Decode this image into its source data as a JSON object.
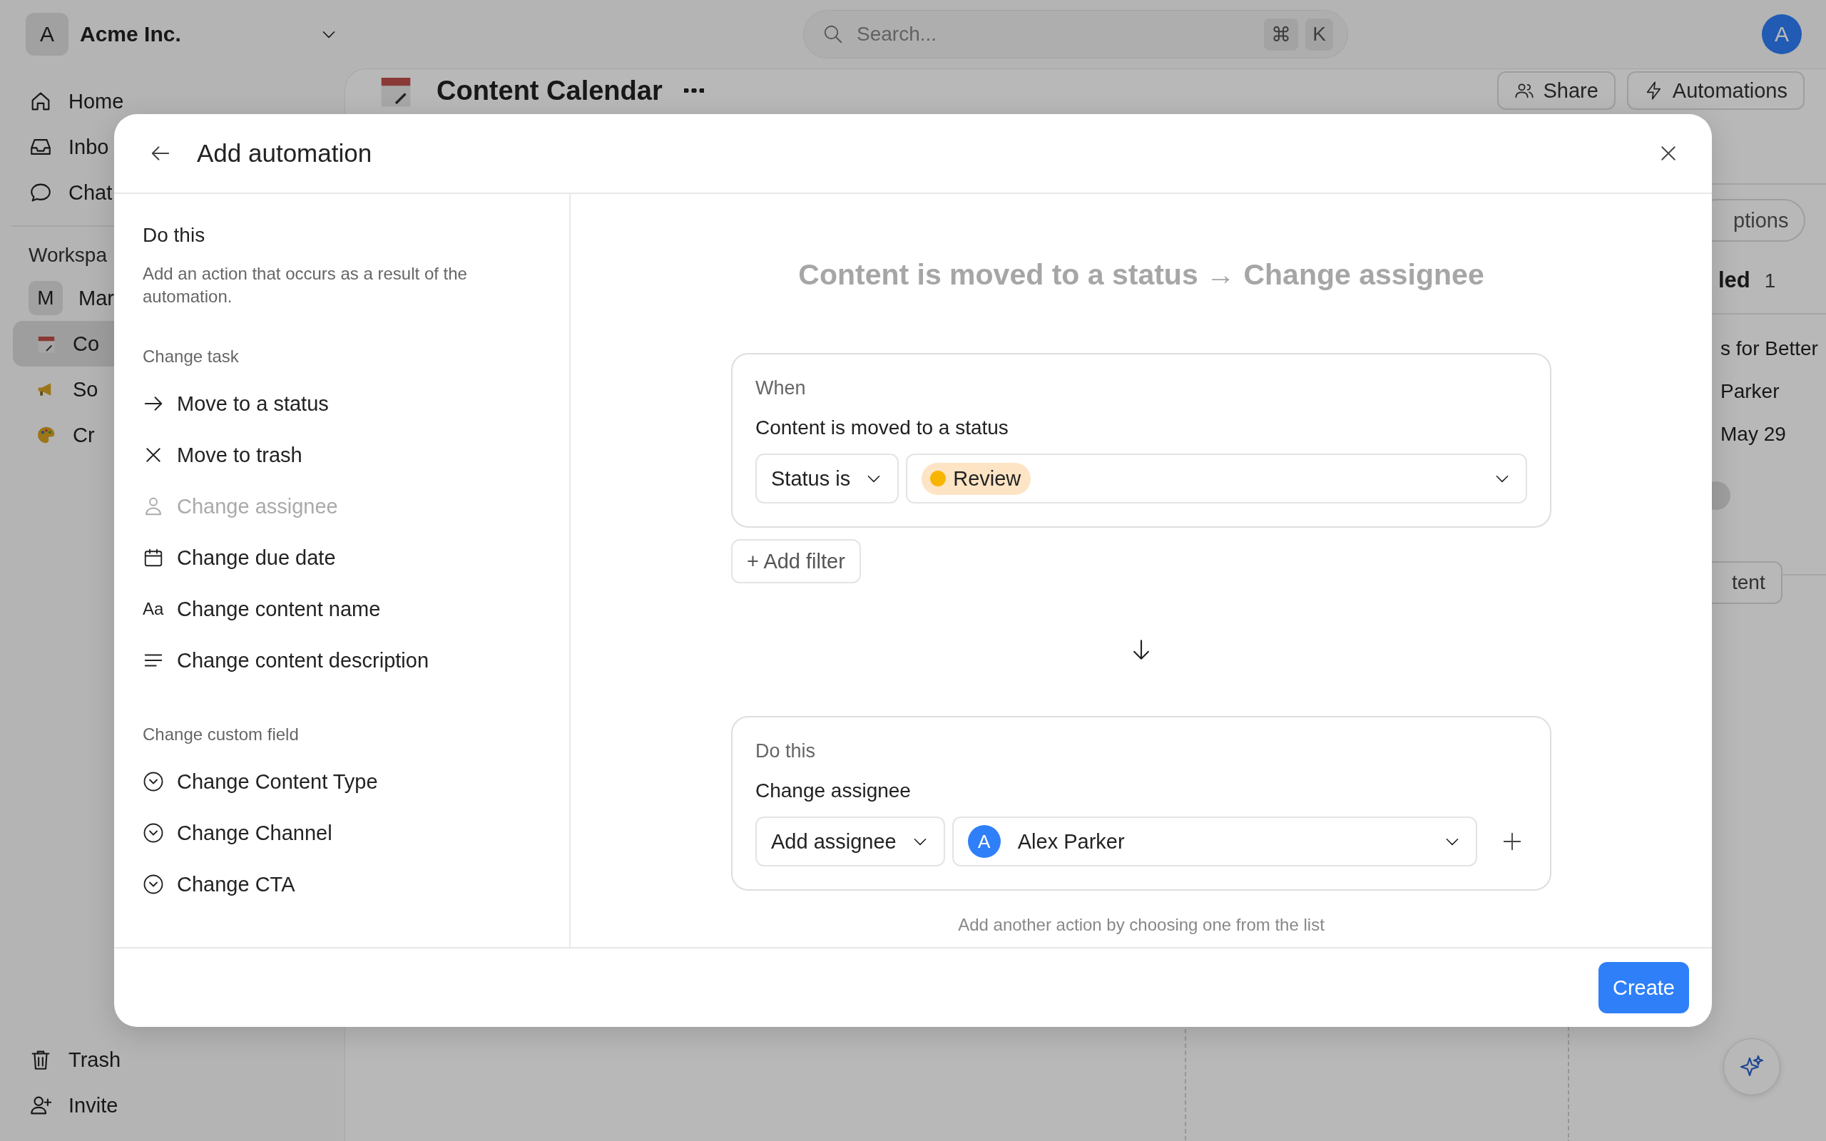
{
  "workspace": {
    "avatar": "A",
    "name": "Acme Inc."
  },
  "search": {
    "placeholder": "Search...",
    "keys": [
      "⌘",
      "K"
    ]
  },
  "user": {
    "avatar": "A"
  },
  "sidebar": {
    "nav": [
      {
        "kind": "home",
        "label": "Home"
      },
      {
        "kind": "inbox",
        "label": "Inbo"
      },
      {
        "kind": "chat",
        "label": "Chat"
      }
    ],
    "section": "Workspa",
    "workspace": {
      "avatar": "M",
      "name": "Mar"
    },
    "items": [
      {
        "kind": "calendar",
        "label": "Co",
        "selected": true
      },
      {
        "kind": "megaphone",
        "label": "So",
        "selected": false
      },
      {
        "kind": "palette",
        "label": "Cr",
        "selected": false
      }
    ],
    "footer": [
      {
        "kind": "trash",
        "label": "Trash"
      },
      {
        "kind": "invite",
        "label": "Invite"
      }
    ]
  },
  "page": {
    "title": "Content Calendar",
    "actions": [
      {
        "kind": "people",
        "label": "Share"
      },
      {
        "kind": "bolt",
        "label": "Automations"
      }
    ],
    "options": "ptions",
    "group": {
      "title": "led",
      "count": "1"
    },
    "card": {
      "title": "s for Better",
      "assignee": "Parker",
      "date": "May 29"
    },
    "add_button": "tent"
  },
  "modal": {
    "title": "Add automation",
    "panel": {
      "heading": "Do this",
      "description": "Add an action that occurs as a result of the automation.",
      "groups": [
        {
          "title": "Change task",
          "items": [
            {
              "kind": "arrow",
              "label": "Move to a status",
              "disabled": false
            },
            {
              "kind": "cross",
              "label": "Move to trash",
              "disabled": false
            },
            {
              "kind": "person",
              "label": "Change assignee",
              "disabled": true
            },
            {
              "kind": "calendar",
              "label": "Change due date",
              "disabled": false
            },
            {
              "kind": "text",
              "glyph": "Aa",
              "label": "Change content name",
              "disabled": false
            },
            {
              "kind": "lines",
              "label": "Change content description",
              "disabled": false
            }
          ]
        },
        {
          "title": "Change custom field",
          "items": [
            {
              "kind": "select",
              "label": "Change Content Type",
              "disabled": false
            },
            {
              "kind": "select",
              "label": "Change Channel",
              "disabled": false
            },
            {
              "kind": "select",
              "label": "Change CTA",
              "disabled": false
            }
          ]
        }
      ]
    },
    "summary": "Content is moved to a status → Change assignee",
    "trigger": {
      "heading": "When",
      "title": "Content is moved to a status",
      "filter": "Status is",
      "value": "Review"
    },
    "add_filter": "+ Add filter",
    "action": {
      "heading": "Do this",
      "title": "Change assignee",
      "mode": "Add assignee",
      "value": {
        "avatar": "A",
        "name": "Alex Parker"
      }
    },
    "hint": "Add another action by choosing one from the list",
    "create": "Create"
  }
}
